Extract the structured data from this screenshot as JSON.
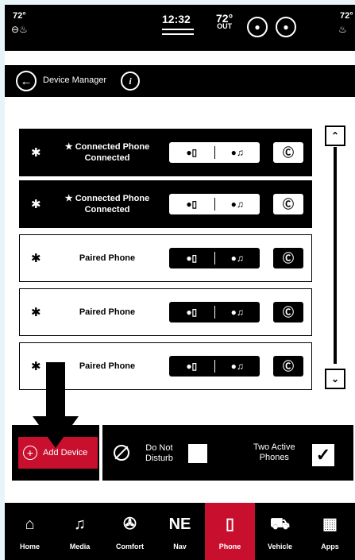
{
  "status_bar": {
    "left_temp": "72°",
    "right_temp": "72°",
    "time": "12:32",
    "outside_temp": "72°",
    "outside_label": "OUT"
  },
  "title_bar": {
    "title": "Device Manager",
    "info_icon": "i"
  },
  "devices": [
    {
      "name_line1": "★ Connected Phone",
      "name_line2": "Connected",
      "state": "connected",
      "phone_profile": "🔲",
      "audio_profile": "♫"
    },
    {
      "name_line1": "★ Connected Phone",
      "name_line2": "Connected",
      "state": "connected",
      "phone_profile": "🔲",
      "audio_profile": "♫"
    },
    {
      "name_line1": "Paired Phone",
      "name_line2": "",
      "state": "paired",
      "phone_profile": "🔲",
      "audio_profile": "♫"
    },
    {
      "name_line1": "Paired Phone",
      "name_line2": "",
      "state": "paired",
      "phone_profile": "🔲",
      "audio_profile": "♫"
    },
    {
      "name_line1": "Paired Phone",
      "name_line2": "",
      "state": "paired",
      "phone_profile": "🔲",
      "audio_profile": "♫"
    }
  ],
  "action_bar": {
    "add_device": "Add Device",
    "do_not_disturb_line1": "Do Not",
    "do_not_disturb_line2": "Disturb",
    "two_active_line1": "Two Active",
    "two_active_line2": "Phones",
    "two_active_checked": true
  },
  "bottom_nav": [
    {
      "label": "Home",
      "icon": "home-icon",
      "active": false
    },
    {
      "label": "Media",
      "icon": "music-note-icon",
      "active": false
    },
    {
      "label": "Comfort",
      "icon": "fan-icon",
      "active": false
    },
    {
      "label": "Nav",
      "icon": "compass-icon",
      "compass_text": "NE",
      "active": false
    },
    {
      "label": "Phone",
      "icon": "phone-icon",
      "active": true
    },
    {
      "label": "Vehicle",
      "icon": "car-icon",
      "active": false
    },
    {
      "label": "Apps",
      "icon": "grid-icon",
      "active": false
    }
  ],
  "colors": {
    "accent_red": "#c8102e",
    "background": "#000000"
  }
}
